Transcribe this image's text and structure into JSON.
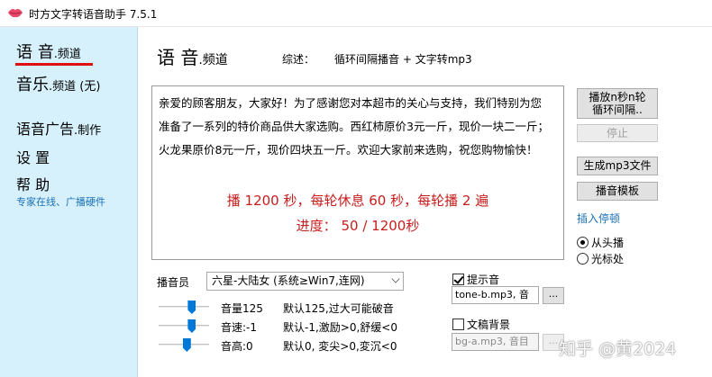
{
  "window": {
    "title": "时方文字转语音助手 7.5.1",
    "icon": "lips-icon",
    "icon_color": "#e8466b"
  },
  "sidebar": {
    "voice_channel": {
      "big": "语 音",
      "small": ".频道"
    },
    "music_channel": {
      "big": "音乐",
      "small": ".频道 (无)"
    },
    "voice_ad": {
      "big": "语音广告",
      "small": ".制作"
    },
    "settings": "设 置",
    "help": "帮 助",
    "help_sub": "专家在线、广播硬件",
    "active_underline_color": "#e01010",
    "background_color": "#d6f1fb"
  },
  "main": {
    "title_big": "语 音",
    "title_small": ".频道",
    "summary_label": "综述：",
    "summary_value": "循环间隔播音 + 文字转mp3",
    "script_text": "亲爱的顾客朋友，大家好！为了感谢您对本超市的关心与支持，我们特别为您准备了一系列的特价商品供大家选购。西红柿原价3元一斤，现价一块二一斤；火龙果原价8元一斤，现价四块五一斤。欢迎大家前来选购，祝您购物愉快！",
    "play_info": "播 1200 秒，每轮休息 60 秒，每轮播 2 遍",
    "progress_label": "进度：",
    "progress_value": "50 / 1200秒",
    "info_color": "#c81d1d"
  },
  "buttons": {
    "play_line1": "播放n秒n轮",
    "play_line2": "循环间隔..",
    "stop": "停止",
    "gen_mp3": "生成mp3文件",
    "template": "播音模板"
  },
  "playback": {
    "insert_pause": "插入停顿",
    "from_start": "从头播",
    "at_cursor": "光标处",
    "selected": "from_start"
  },
  "announcer": {
    "label": "播音员",
    "value": "六星-大陆女 (系统≥Win7,连网)"
  },
  "sliders": {
    "volume": {
      "label": "音量125",
      "hint": "默认125,过大可能破音",
      "level": 0.65
    },
    "speed": {
      "label": "音速:-1",
      "hint": "默认-1,激励>0,舒缓<0",
      "level": 0.65
    },
    "pitch": {
      "label": "音高:0",
      "hint": "默认0, 変尖>0,変沉<0",
      "level": 0.55
    }
  },
  "tone": {
    "label": "提示音",
    "checked": true,
    "file": "tone-b.mp3, 音",
    "browse": "..."
  },
  "background": {
    "label": "文稿背景",
    "checked": false,
    "file": "bg-a.mp3, 音目",
    "browse": "..."
  },
  "watermark": "知乎 @黄2024"
}
